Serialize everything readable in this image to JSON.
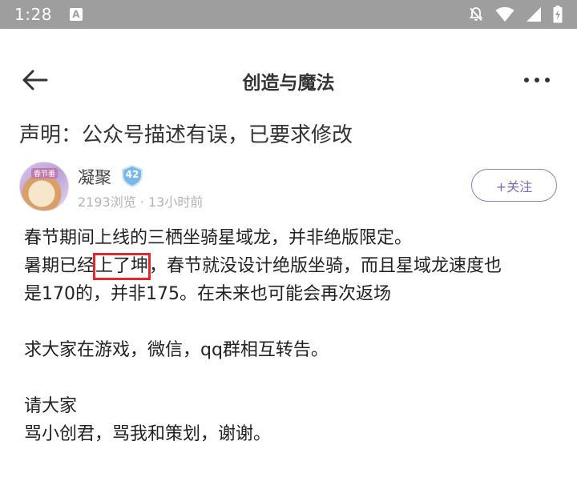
{
  "status_bar": {
    "time": "1:28",
    "notification_icon_letter": "A",
    "icons": [
      "notifications-off-icon",
      "wifi-icon",
      "cellular-signal-icon",
      "battery-charging-icon"
    ]
  },
  "app_bar": {
    "title": "创造与魔法",
    "back_icon": "back-arrow-icon",
    "more_icon": "more-options-icon"
  },
  "post": {
    "title": "声明：公众号描述有误，已要求修改",
    "author": {
      "name": "凝聚",
      "level": "42",
      "avatar_tag": "春节番",
      "meta": "2193浏览 · 13小时前"
    },
    "follow_label": "+关注",
    "body": {
      "line1": "春节期间上线的三栖坐骑星域龙，并非绝版限定。",
      "line2_before": "暑期已经",
      "line2_highlight": "上了坤",
      "line2_after": "，春节就没设计绝版坐骑，而且星域龙速度也",
      "line3": "是170的，并非175。在未来也可能会再次返场",
      "line4": "求大家在游戏，微信，qq群相互转告。",
      "line5": "请大家",
      "line6": "骂小创君，骂我和策划，谢谢。"
    }
  },
  "colors": {
    "accent": "#8e7cc3",
    "highlight_box": "#e0282e",
    "status_bar": "#9e9e9e"
  }
}
